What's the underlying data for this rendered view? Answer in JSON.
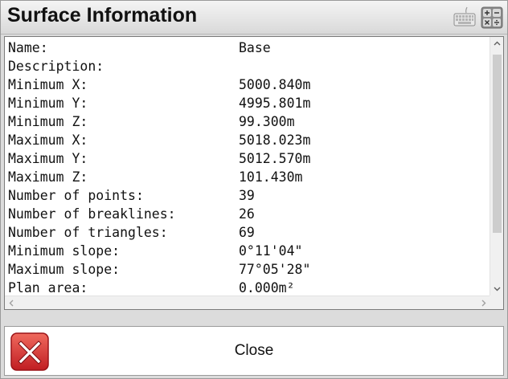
{
  "window": {
    "title": "Surface Information"
  },
  "toolbar_icons": [
    "keyboard-icon",
    "calculator-icon"
  ],
  "info_rows": [
    {
      "label": "Name:",
      "value": "Base"
    },
    {
      "label": "Description:",
      "value": ""
    },
    {
      "label": "Minimum X:",
      "value": "5000.840m"
    },
    {
      "label": "Minimum Y:",
      "value": "4995.801m"
    },
    {
      "label": "Minimum Z:",
      "value": "99.300m"
    },
    {
      "label": "Maximum X:",
      "value": "5018.023m"
    },
    {
      "label": "Maximum Y:",
      "value": "5012.570m"
    },
    {
      "label": "Maximum Z:",
      "value": "101.430m"
    },
    {
      "label": "Number of points:",
      "value": "39"
    },
    {
      "label": "Number of breaklines:",
      "value": "26"
    },
    {
      "label": "Number of triangles:",
      "value": "69"
    },
    {
      "label": "Minimum slope:",
      "value": "0°11'04\""
    },
    {
      "label": "Maximum slope:",
      "value": "77°05'28\""
    },
    {
      "label": "Plan area:",
      "value": "0.000m²"
    }
  ],
  "footer": {
    "close_label": "Close"
  },
  "colors": {
    "close_icon_red": "#d8262b",
    "title_bar": "#e4e4e4"
  }
}
